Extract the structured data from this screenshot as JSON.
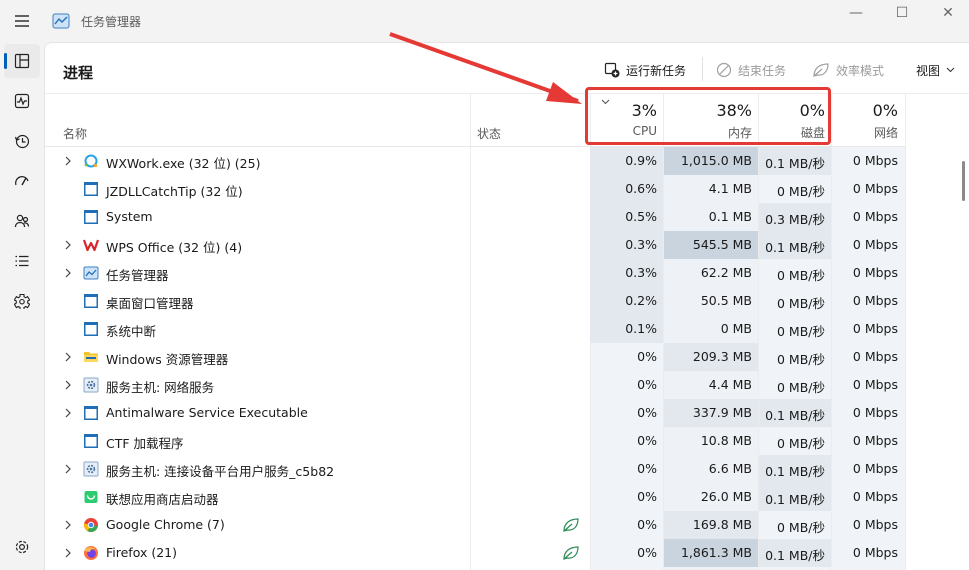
{
  "window": {
    "title": "任务管理器",
    "minimize": "—",
    "maximize": "☐",
    "close": "✕"
  },
  "sidebar": {
    "items": [
      "processes-icon",
      "performance-icon",
      "app-history-icon",
      "startup-icon",
      "users-icon",
      "details-icon",
      "services-icon"
    ],
    "settings": "settings-icon"
  },
  "toolbar": {
    "title": "进程",
    "run_new_task": "运行新任务",
    "end_task": "结束任务",
    "efficiency_mode": "效率模式",
    "view": "视图"
  },
  "columns": {
    "name": "名称",
    "status": "状态",
    "cpu": {
      "percent": "3%",
      "label": "CPU"
    },
    "memory": {
      "percent": "38%",
      "label": "内存"
    },
    "disk": {
      "percent": "0%",
      "label": "磁盘"
    },
    "network": {
      "percent": "0%",
      "label": "网络"
    }
  },
  "rows": [
    {
      "name": "WXWork.exe (32 位) (25)",
      "cpu": "0.9%",
      "mem": "1,015.0 MB",
      "disk": "0.1 MB/秒",
      "net": "0 Mbps",
      "expand": true,
      "icon": "wxwork-icon",
      "eco": false
    },
    {
      "name": "JZDLLCatchTip (32 位)",
      "cpu": "0.6%",
      "mem": "4.1 MB",
      "disk": "0 MB/秒",
      "net": "0 Mbps",
      "expand": false,
      "icon": "app-window-icon",
      "eco": false
    },
    {
      "name": "System",
      "cpu": "0.5%",
      "mem": "0.1 MB",
      "disk": "0.3 MB/秒",
      "net": "0 Mbps",
      "expand": false,
      "icon": "app-window-icon",
      "eco": false
    },
    {
      "name": "WPS Office (32 位) (4)",
      "cpu": "0.3%",
      "mem": "545.5 MB",
      "disk": "0.1 MB/秒",
      "net": "0 Mbps",
      "expand": true,
      "icon": "wps-icon",
      "eco": false
    },
    {
      "name": "任务管理器",
      "cpu": "0.3%",
      "mem": "62.2 MB",
      "disk": "0 MB/秒",
      "net": "0 Mbps",
      "expand": true,
      "icon": "task-manager-icon",
      "eco": false
    },
    {
      "name": "桌面窗口管理器",
      "cpu": "0.2%",
      "mem": "50.5 MB",
      "disk": "0 MB/秒",
      "net": "0 Mbps",
      "expand": false,
      "icon": "app-window-icon",
      "eco": false
    },
    {
      "name": "系统中断",
      "cpu": "0.1%",
      "mem": "0 MB",
      "disk": "0 MB/秒",
      "net": "0 Mbps",
      "expand": false,
      "icon": "app-window-icon",
      "eco": false
    },
    {
      "name": "Windows 资源管理器",
      "cpu": "0%",
      "mem": "209.3 MB",
      "disk": "0 MB/秒",
      "net": "0 Mbps",
      "expand": true,
      "icon": "folder-icon",
      "eco": false
    },
    {
      "name": "服务主机: 网络服务",
      "cpu": "0%",
      "mem": "4.4 MB",
      "disk": "0 MB/秒",
      "net": "0 Mbps",
      "expand": true,
      "icon": "service-gear-icon",
      "eco": false
    },
    {
      "name": "Antimalware Service Executable",
      "cpu": "0%",
      "mem": "337.9 MB",
      "disk": "0.1 MB/秒",
      "net": "0 Mbps",
      "expand": true,
      "icon": "app-window-icon",
      "eco": false
    },
    {
      "name": "CTF 加载程序",
      "cpu": "0%",
      "mem": "10.8 MB",
      "disk": "0 MB/秒",
      "net": "0 Mbps",
      "expand": false,
      "icon": "app-window-icon",
      "eco": false
    },
    {
      "name": "服务主机: 连接设备平台用户服务_c5b82",
      "cpu": "0%",
      "mem": "6.6 MB",
      "disk": "0.1 MB/秒",
      "net": "0 Mbps",
      "expand": true,
      "icon": "service-gear-icon",
      "eco": false
    },
    {
      "name": "联想应用商店启动器",
      "cpu": "0%",
      "mem": "26.0 MB",
      "disk": "0.1 MB/秒",
      "net": "0 Mbps",
      "expand": false,
      "icon": "lenovo-store-icon",
      "eco": false
    },
    {
      "name": "Google Chrome (7)",
      "cpu": "0%",
      "mem": "169.8 MB",
      "disk": "0 MB/秒",
      "net": "0 Mbps",
      "expand": true,
      "icon": "chrome-icon",
      "eco": true
    },
    {
      "name": "Firefox (21)",
      "cpu": "0%",
      "mem": "1,861.3 MB",
      "disk": "0.1 MB/秒",
      "net": "0 Mbps",
      "expand": true,
      "icon": "firefox-icon",
      "eco": true
    }
  ],
  "colors": {
    "usage_low": "#f0f4f8",
    "usage_mid": "#e2e8ee",
    "usage_high": "#c9d4de",
    "accent": "#005fb8",
    "callout": "#e53935"
  }
}
